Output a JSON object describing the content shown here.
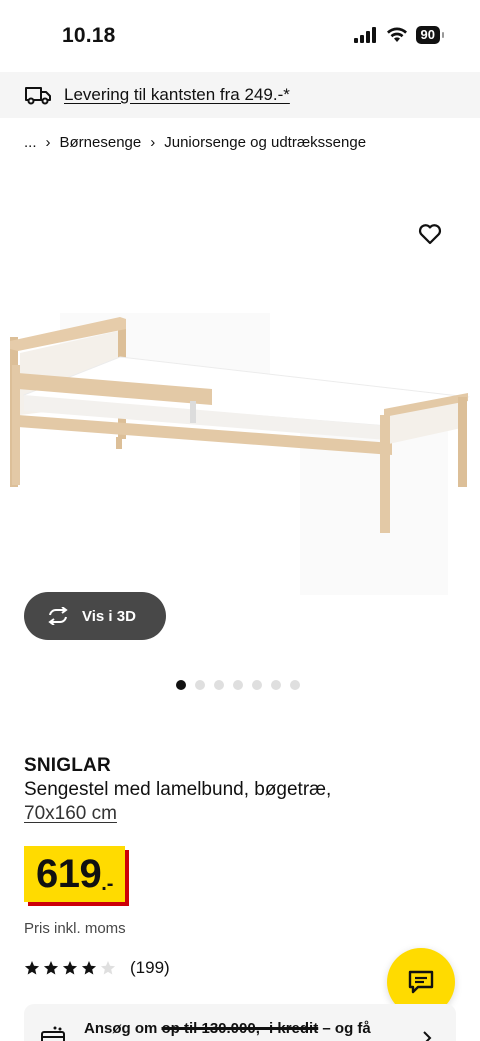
{
  "status_bar": {
    "time": "10.18",
    "battery": "90"
  },
  "delivery_banner": {
    "text": "Levering til kantsten fra 249.-*",
    "icon": "truck-icon"
  },
  "breadcrumb": {
    "ellipsis": "...",
    "sep": "›",
    "items": [
      "Børnesenge",
      "Juniorsenge og udtrækssenge"
    ]
  },
  "product_image": {
    "alt": "SNIGLAR bed frame",
    "wood_color": "#e3c9a6",
    "panel_color": "#f4f0ea"
  },
  "favorite": {
    "icon": "heart-icon"
  },
  "view_3d": {
    "label": "Vis i 3D",
    "icon": "rotate-icon"
  },
  "carousel": {
    "count": 7,
    "active": 0
  },
  "product": {
    "name": "SNIGLAR",
    "description": "Sengestel med lamelbund, bøgetræ,",
    "size": "70x160 cm"
  },
  "price": {
    "amount": "619",
    "suffix": ".-",
    "vat_note": "Pris inkl. moms"
  },
  "rating": {
    "stars": 4,
    "max": 5,
    "count": "(199)"
  },
  "credit": {
    "before": "Ansøg om ",
    "strike": "op til 130.000,- i kredit",
    "after": " – og få",
    "icon": "credit-icon"
  },
  "chat": {
    "icon": "chat-icon"
  },
  "colors": {
    "ikea_yellow": "#ffdb00",
    "ikea_red": "#cc0008",
    "button_dark": "#484848"
  }
}
